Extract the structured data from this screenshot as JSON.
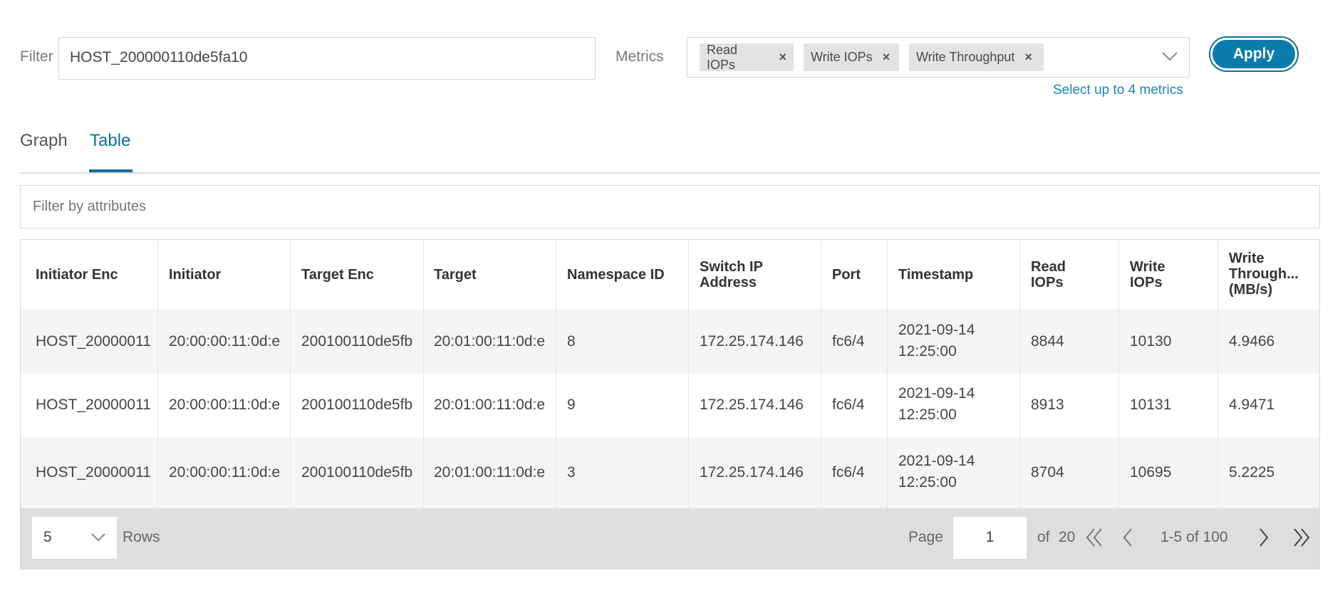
{
  "filter": {
    "label": "Filter",
    "value": "HOST_200000110de5fa10"
  },
  "metrics": {
    "label": "Metrics",
    "chips": [
      "Read IOPs",
      "Write IOPs",
      "Write Throughput"
    ],
    "hint": "Select up to 4 metrics"
  },
  "apply_label": "Apply",
  "tabs": [
    {
      "label": "Graph",
      "active": false
    },
    {
      "label": "Table",
      "active": true
    }
  ],
  "attr_filter": {
    "placeholder": "Filter by attributes"
  },
  "table": {
    "headers": [
      [
        "Initiator Enc"
      ],
      [
        "Initiator"
      ],
      [
        "Target Enc"
      ],
      [
        "Target"
      ],
      [
        "Namespace ID"
      ],
      [
        "Switch IP",
        "Address"
      ],
      [
        "Port"
      ],
      [
        "Timestamp"
      ],
      [
        "Read",
        "IOPs"
      ],
      [
        "Write",
        "IOPs"
      ],
      [
        "Write",
        "Through...",
        "(MB/s)"
      ]
    ],
    "rows": [
      [
        "HOST_20000011",
        "20:00:00:11:0d:e",
        "200100110de5fb",
        "20:01:00:11:0d:e",
        "8",
        "172.25.174.146",
        "fc6/4",
        [
          "2021-09-14",
          "12:25:00"
        ],
        "8844",
        "10130",
        "4.9466"
      ],
      [
        "HOST_20000011",
        "20:00:00:11:0d:e",
        "200100110de5fb",
        "20:01:00:11:0d:e",
        "9",
        "172.25.174.146",
        "fc6/4",
        [
          "2021-09-14",
          "12:25:00"
        ],
        "8913",
        "10131",
        "4.9471"
      ],
      [
        "HOST_20000011",
        "20:00:00:11:0d:e",
        "200100110de5fb",
        "20:01:00:11:0d:e",
        "3",
        "172.25.174.146",
        "fc6/4",
        [
          "2021-09-14",
          "12:25:00"
        ],
        "8704",
        "10695",
        "5.2225"
      ]
    ]
  },
  "pagination": {
    "rows_value": "5",
    "rows_label": "Rows",
    "page_label": "Page",
    "page_value": "1",
    "of_label": "of",
    "total_pages": "20",
    "range": "1-5 of 100"
  },
  "colors": {
    "accent": "#0b7bab",
    "tab_active": "#0b6f9c",
    "hint": "#1d86b5"
  }
}
